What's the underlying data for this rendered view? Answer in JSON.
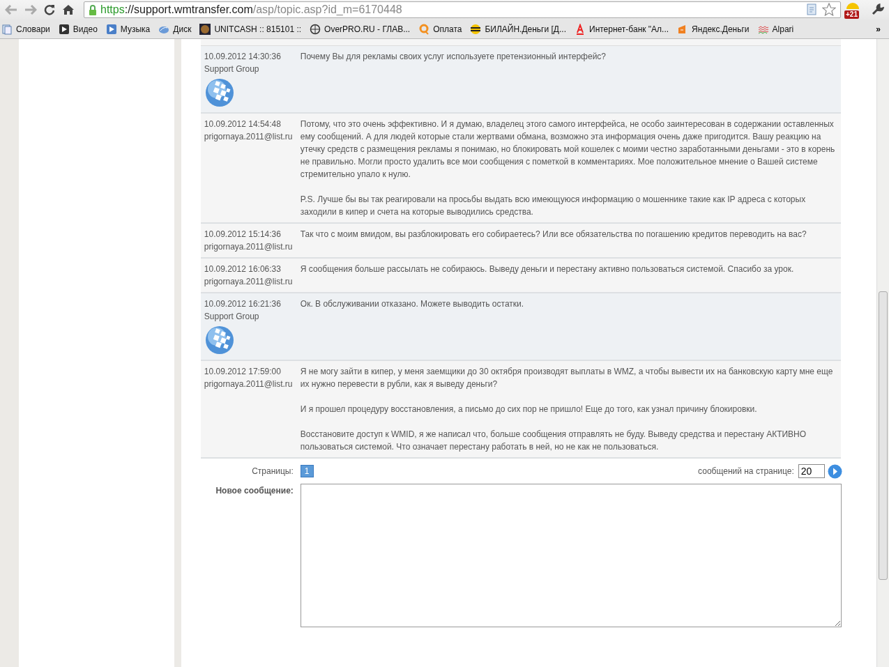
{
  "browser": {
    "url_scheme": "https",
    "url_host": "://support.wmtransfer.com",
    "url_path": "/asp/topic.asp?id_m=6170448",
    "badge": "+21"
  },
  "bookmarks": [
    {
      "label": "Словари",
      "kind": "book"
    },
    {
      "label": "Видео",
      "kind": "play"
    },
    {
      "label": "Музыка",
      "kind": "note"
    },
    {
      "label": "Диск",
      "kind": "cloud"
    },
    {
      "label": "UNITCASH :: 815101 ::",
      "kind": "coin"
    },
    {
      "label": "OverPRO.RU - ГЛАВ...",
      "kind": "target"
    },
    {
      "label": "Оплата",
      "kind": "ring"
    },
    {
      "label": "БИЛАЙН.Деньги [Д...",
      "kind": "stripes"
    },
    {
      "label": "Интернет-банк \"Ал...",
      "kind": "letter"
    },
    {
      "label": "Яндекс.Деньги",
      "kind": "wallet"
    },
    {
      "label": "Alpari",
      "kind": "waves"
    }
  ],
  "overflow": "»",
  "messages": [
    {
      "date": "10.09.2012 14:30:36",
      "author": "Support Group",
      "kind": "support",
      "paragraphs": [
        "Почему Вы для рекламы своих услуг используете претензионный интерфейс?"
      ]
    },
    {
      "date": "10.09.2012 14:54:48",
      "author": "prigornaya.2011@list.ru",
      "kind": "user",
      "paragraphs": [
        "Потому, что это очень эффективно. И я думаю, владелец этого самого интерфейса, не особо заинтересован в содержании оставленных ему сообщений. А для людей которые стали жертвами обмана, возможно эта информация очень даже пригодится. Вашу реакцию на утечку средств с размещения рекламы я понимаю, но блокировать мой кошелек с моими честно заработанными деньгами - это в корень не правильно. Могли просто удалить все мои сообщения с пометкой в комментариях. Мое положительное мнение о Вашей системе стремительно упало к нулю.",
        "P.S. Лучше бы вы так реагировали на просьбы выдать всю имеющуюся информацию о мошеннике такие как IP адреса с которых заходили в кипер и счета на которые выводились средства."
      ]
    },
    {
      "date": "10.09.2012 15:14:36",
      "author": "prigornaya.2011@list.ru",
      "kind": "user",
      "paragraphs": [
        "Так что с моим вмидом, вы разблокировать его собираетесь? Или все обязательства по погашению кредитов переводить на вас?"
      ]
    },
    {
      "date": "10.09.2012 16:06:33",
      "author": "prigornaya.2011@list.ru",
      "kind": "user",
      "paragraphs": [
        "Я сообщения больше рассылать не собираюсь. Выведу деньги и перестану активно пользоваться системой. Спасибо за урок."
      ]
    },
    {
      "date": "10.09.2012 16:21:36",
      "author": "Support Group",
      "kind": "support",
      "paragraphs": [
        "Ок. В обслуживании отказано. Можете выводить остатки."
      ]
    },
    {
      "date": "10.09.2012 17:59:00",
      "author": "prigornaya.2011@list.ru",
      "kind": "user",
      "paragraphs": [
        "Я не могу зайти в кипер, у меня заемщики до 30 октября производят выплаты в WMZ, а чтобы вывести их на банковскую карту мне еще их нужно перевести в рубли, как я выведу деньги?",
        "И я прошел процедуру восстановления, а письмо до сих пор не пришло! Еще до того, как узнал причину блокировки.",
        "Восстановите доступ к WMID, я же написал что, больше сообщения отправлять не буду. Выведу средства и перестану АКТИВНО пользоваться системой. Что означает перестану работать в ней, но не как не пользоваться."
      ]
    }
  ],
  "pager": {
    "label": "Страницы:",
    "pages": [
      {
        "label": "1",
        "selected": true
      }
    ],
    "per_page_label": "сообщений на странице:",
    "per_page_value": "20"
  },
  "new_message": {
    "label": "Новое сообщение:"
  }
}
